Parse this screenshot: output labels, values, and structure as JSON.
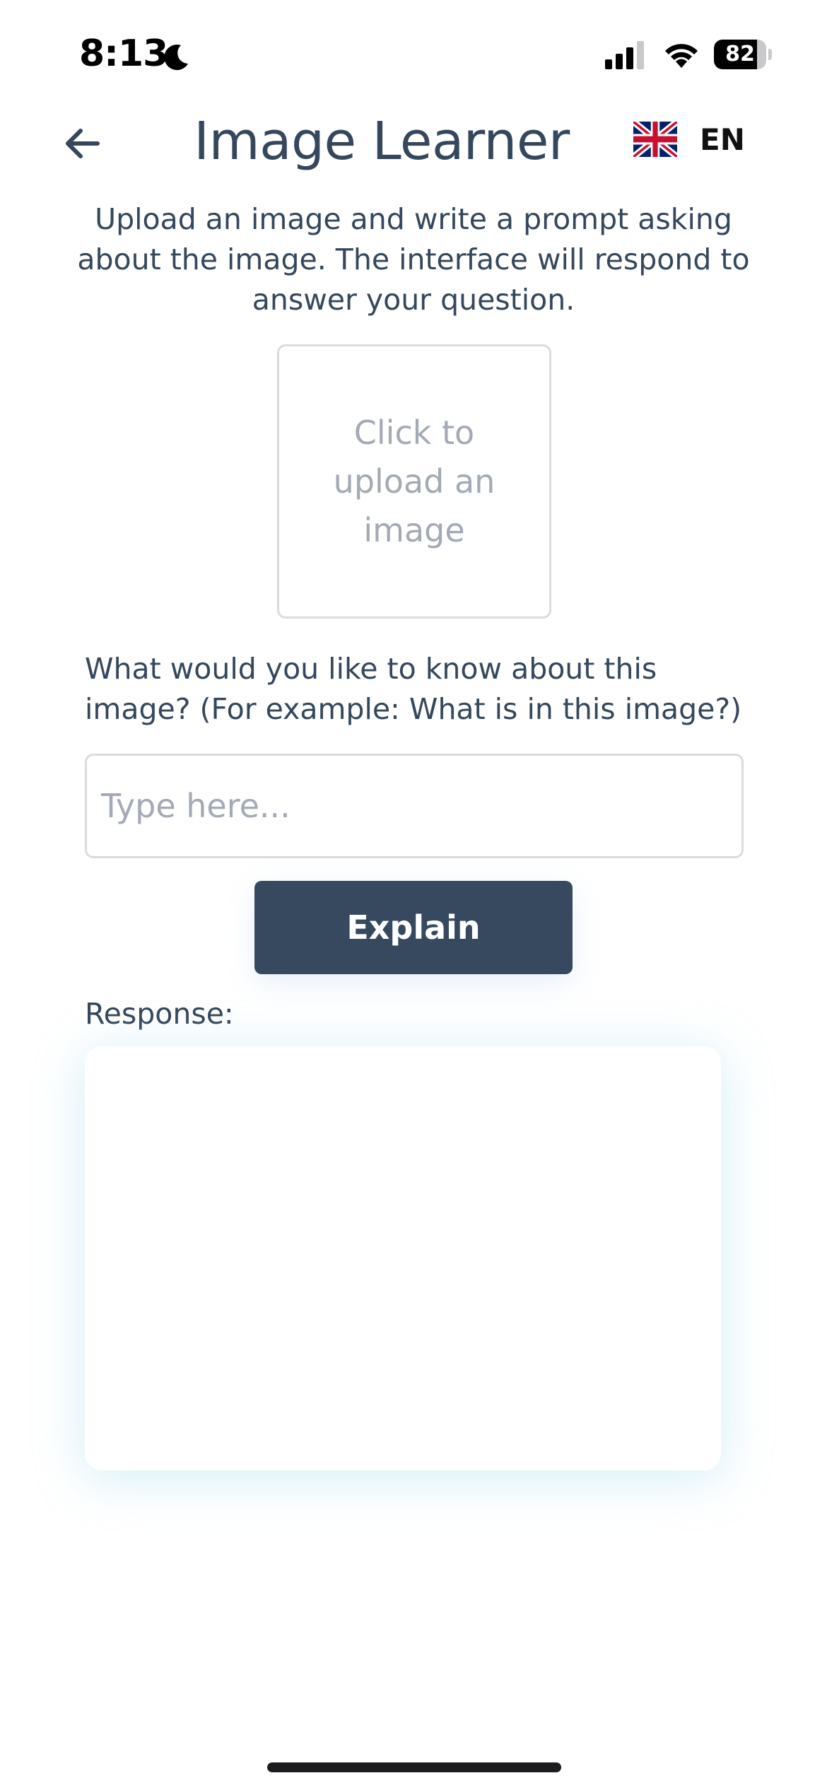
{
  "status_bar": {
    "time": "8:13",
    "battery_percent": "82",
    "battery_level": 0.82,
    "icons": [
      "moon-icon",
      "signal-icon",
      "wifi-icon",
      "battery-icon"
    ]
  },
  "header": {
    "back_icon": "arrow-left-icon",
    "title": "Image Learner",
    "language": {
      "flag_icon": "uk-flag-icon",
      "code": "EN"
    }
  },
  "intro": {
    "text": "Upload an image and write a prompt asking about the image. The interface will respond to answer your question."
  },
  "upload": {
    "label": "Click to upload an image"
  },
  "prompt": {
    "label": "What would you like to know about this image? (For example: What is in this image?)",
    "value": "",
    "placeholder": "Type here..."
  },
  "actions": {
    "explain_label": "Explain"
  },
  "response": {
    "label": "Response:",
    "text": ""
  },
  "colors": {
    "text": "#34475c",
    "button_bg": "#36495e",
    "placeholder": "#a3a9b5",
    "border": "#d9dbe0"
  }
}
